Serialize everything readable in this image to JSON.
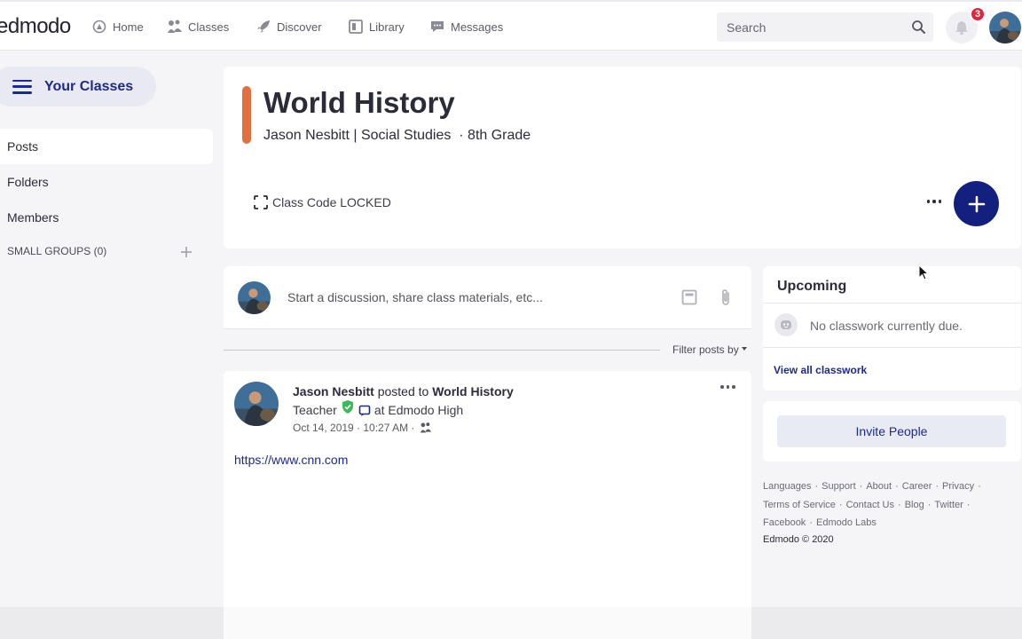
{
  "topbar": {
    "logo": "edmodo",
    "nav": [
      {
        "label": "Home",
        "icon": "home-icon"
      },
      {
        "label": "Classes",
        "icon": "classes-icon"
      },
      {
        "label": "Discover",
        "icon": "rocket-icon"
      },
      {
        "label": "Library",
        "icon": "library-icon"
      },
      {
        "label": "Messages",
        "icon": "messages-icon"
      }
    ],
    "search_placeholder": "Search",
    "notification_count": "3"
  },
  "sidebar": {
    "your_classes": "Your Classes",
    "items": [
      {
        "label": "Posts",
        "active": true
      },
      {
        "label": "Folders",
        "active": false
      },
      {
        "label": "Members",
        "active": false
      }
    ],
    "small_groups": "SMALL GROUPS (0)"
  },
  "class": {
    "title": "World History",
    "subtitle": "Jason Nesbitt | Social Studies  · 8th Grade",
    "code_label": "Class Code LOCKED",
    "accent_color": "#e07040"
  },
  "composer": {
    "placeholder": "Start a discussion, share class materials, etc..."
  },
  "filter": {
    "label": "Filter posts by"
  },
  "post": {
    "author": "Jason Nesbitt",
    "posted_to": "posted to",
    "target": "World History",
    "role": "Teacher",
    "school": "at Edmodo High",
    "timestamp": "Oct 14, 2019 · 10:27 AM ·",
    "link": "https://www.cnn.com"
  },
  "upcoming": {
    "title": "Upcoming",
    "empty": "No classwork currently due.",
    "view_all": "View all classwork"
  },
  "invite": {
    "label": "Invite People"
  },
  "footer": {
    "links": [
      "Languages",
      "Support",
      "About",
      "Career",
      "Privacy",
      "Terms of Service",
      "Contact Us",
      "Blog",
      "Twitter",
      "Facebook",
      "Edmodo Labs"
    ],
    "copyright": "Edmodo © 2020"
  },
  "colors": {
    "brand": "#14207e",
    "link": "#1d2a8a",
    "badge": "#e0263c",
    "verified": "#3cb95a"
  }
}
